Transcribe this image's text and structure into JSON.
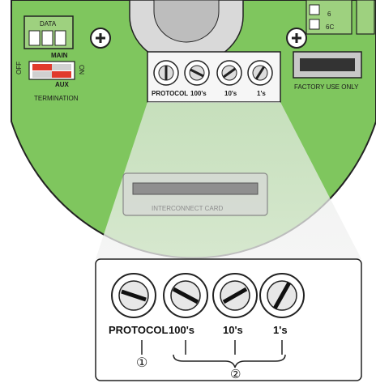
{
  "board": {
    "data_label": "DATA",
    "termination": {
      "off_label": "OFF",
      "on_label": "ON",
      "main_label": "MAIN",
      "aux_label": "AUX",
      "caption": "TERMINATION"
    },
    "switches": [
      {
        "label": "PROTOCOL",
        "arrow": "0"
      },
      {
        "label": "100's",
        "arrow": "0"
      },
      {
        "label": "10's",
        "arrow": "2"
      },
      {
        "label": "1's",
        "arrow": "5"
      }
    ],
    "factory_label": "FACTORY USE ONLY",
    "interconnect_label": "INTERCONNECT CARD",
    "connector_numbers": [
      "6",
      "6C"
    ]
  },
  "callout": {
    "switches": [
      {
        "label": "PROTOCOL"
      },
      {
        "label": "100's"
      },
      {
        "label": "10's"
      },
      {
        "label": "1's"
      }
    ],
    "markers": [
      "①",
      "②"
    ]
  },
  "colors": {
    "board": "#7fc65e",
    "outline": "#222222",
    "switch_red": "#e03a2c"
  }
}
